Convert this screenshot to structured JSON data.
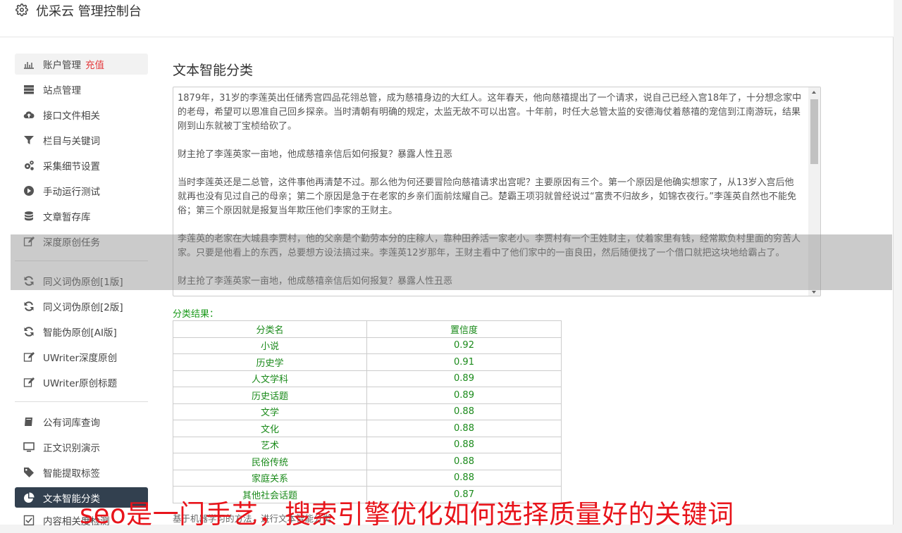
{
  "header": {
    "title": "优采云 管理控制台"
  },
  "sidebar": {
    "groups": [
      [
        {
          "label": "账户管理",
          "badge": "充值",
          "icon": "bar-chart-icon",
          "state": "first"
        },
        {
          "label": "站点管理",
          "icon": "server-icon"
        },
        {
          "label": "接口文件相关",
          "icon": "cloud-upload-icon"
        },
        {
          "label": "栏目与关键词",
          "icon": "filter-icon"
        },
        {
          "label": "采集细节设置",
          "icon": "gears-icon"
        },
        {
          "label": "手动运行测试",
          "icon": "play-circle-icon"
        },
        {
          "label": "文章暂存库",
          "icon": "database-icon"
        },
        {
          "label": "深度原创任务",
          "icon": "edit-icon"
        }
      ],
      [
        {
          "label": "同义词伪原创[1版]",
          "icon": "refresh-icon"
        },
        {
          "label": "同义词伪原创[2版]",
          "icon": "refresh-icon"
        },
        {
          "label": "智能伪原创[AI版]",
          "icon": "refresh-icon"
        },
        {
          "label": "UWriter深度原创",
          "icon": "edit-icon"
        },
        {
          "label": "UWriter原创标题",
          "icon": "edit-icon"
        }
      ],
      [
        {
          "label": "公有词库查询",
          "icon": "book-icon"
        },
        {
          "label": "正文识别演示",
          "icon": "monitor-icon"
        },
        {
          "label": "智能提取标签",
          "icon": "tag-icon"
        },
        {
          "label": "文本智能分类",
          "icon": "pie-chart-icon",
          "state": "active"
        },
        {
          "label": "内容相关度检测",
          "icon": "check-icon"
        }
      ]
    ]
  },
  "main": {
    "title": "文本智能分类",
    "text_paragraphs": [
      "1879年，31岁的李莲英出任储秀宫四品花翎总管，成为慈禧身边的大红人。这年春天，他向慈禧提出了一个请求，说自己已经入宫18年了，十分想念家中的老母，希望可以恩准自己回乡探亲。当时清朝有明确的规定，太监无故不可以出宫。十年前，时任大总管太监的安德海仗着慈禧的宠信到江南游玩，结果刚到山东就被丁宝桢给砍了。",
      "财主抢了李莲英家一亩地，他成慈禧亲信后如何报复？暴露人性丑恶",
      "当时李莲英还是二总管，这件事他再清楚不过。那么他为何还要冒险向慈禧请求出宫呢？主要原因有三个。第一个原因是他确实想家了，从13岁入宫后他就再也没有见过自己的母亲；第二个原因是急于在老家的乡亲们面前炫耀自己。楚霸王项羽就曾经说过“富贵不归故乡，如锦衣夜行。”李莲英自然也不能免俗；第三个原因就是报复当年欺压他们李家的王财主。",
      "李莲英的老家在大城县李贾村，他的父亲是个勤劳本分的庄稼人，靠种田养活一家老小。李贾村有一个王姓财主，仗着家里有钱，经常欺负村里面的穷苦人家。只要是他看上的东西，总要想方设法搞过来。李莲英12岁那年，王财主看中了他们家中的一亩良田，然后随便找了一个借口就把这块地给霸占了。",
      "财主抢了李莲英家一亩地，他成慈禧亲信后如何报复？暴露人性丑恶"
    ],
    "result_label": "分类结果：",
    "table": {
      "headers": [
        "分类名",
        "置信度"
      ],
      "rows": [
        [
          "小说",
          "0.92"
        ],
        [
          "历史学",
          "0.91"
        ],
        [
          "人文学科",
          "0.89"
        ],
        [
          "历史话题",
          "0.89"
        ],
        [
          "文学",
          "0.88"
        ],
        [
          "文化",
          "0.88"
        ],
        [
          "艺术",
          "0.88"
        ],
        [
          "民俗传统",
          "0.88"
        ],
        [
          "家庭关系",
          "0.88"
        ],
        [
          "其他社会话题",
          "0.87"
        ]
      ]
    },
    "footnote": "基于机器学习的方法，进行文本智能分类"
  },
  "overlay_text": "seo是一门手艺，搜索引擎优化如何选择质量好的关键词",
  "colors": {
    "active_bg": "#32404f",
    "green": "#1a8a1a",
    "red": "#e8141b"
  }
}
